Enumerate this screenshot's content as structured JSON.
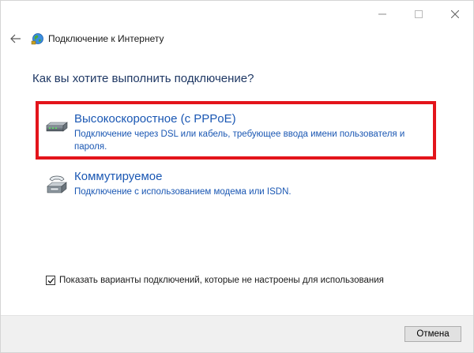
{
  "window": {
    "title": "Подключение к Интернету",
    "controls": {
      "minimize_icon": "minimize-icon",
      "maximize_icon": "maximize-icon",
      "close_icon": "close-icon"
    }
  },
  "nav": {
    "back_icon": "back-arrow-icon",
    "app_icon": "internet-connection-icon"
  },
  "main": {
    "heading": "Как вы хотите выполнить подключение?",
    "options": [
      {
        "title": "Высокоскоростное (с PPPoE)",
        "description": "Подключение через DSL или кабель, требующее ввода имени пользователя и пароля.",
        "icon": "broadband-modem-icon",
        "highlighted": true
      },
      {
        "title": "Коммутируемое",
        "description": "Подключение с использованием модема или ISDN.",
        "icon": "dialup-phone-icon",
        "highlighted": false
      }
    ],
    "highlight_color": "#e3141b",
    "link_color": "#1a57b3"
  },
  "options_checkbox": {
    "label": "Показать варианты подключений, которые не настроены для использования",
    "checked": true
  },
  "footer": {
    "cancel_label": "Отмена"
  }
}
